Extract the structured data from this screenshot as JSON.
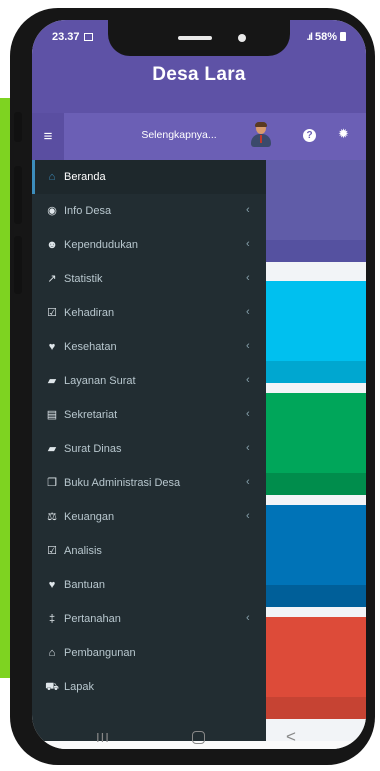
{
  "status": {
    "time": "23.37",
    "signal": ".ıl",
    "battery": "58%"
  },
  "app": {
    "title": "Desa Lara"
  },
  "navbar": {
    "toggle_icon": "menu-icon",
    "title": "Selengkapnya...",
    "avatar_icon": "user-avatar",
    "help_icon": "question-circle-icon",
    "settings_icon": "gear-icon"
  },
  "sidebar": {
    "items": [
      {
        "label": "Beranda",
        "icon": "home-icon",
        "glyph": "⌂",
        "has_submenu": false,
        "active": true
      },
      {
        "label": "Info Desa",
        "icon": "dashboard-icon",
        "glyph": "◉",
        "has_submenu": true
      },
      {
        "label": "Kependudukan",
        "icon": "users-icon",
        "glyph": "☻",
        "has_submenu": true
      },
      {
        "label": "Statistik",
        "icon": "line-chart-icon",
        "glyph": "↗",
        "has_submenu": true
      },
      {
        "label": "Kehadiran",
        "icon": "calendar-check-icon",
        "glyph": "☑",
        "has_submenu": true
      },
      {
        "label": "Kesehatan",
        "icon": "heartbeat-icon",
        "glyph": "♥",
        "has_submenu": true
      },
      {
        "label": "Layanan Surat",
        "icon": "book-icon",
        "glyph": "▰",
        "has_submenu": true
      },
      {
        "label": "Sekretariat",
        "icon": "archive-icon",
        "glyph": "▤",
        "has_submenu": true
      },
      {
        "label": "Surat Dinas",
        "icon": "book-icon",
        "glyph": "▰",
        "has_submenu": true
      },
      {
        "label": "Buku Administrasi Desa",
        "icon": "copy-icon",
        "glyph": "❐",
        "has_submenu": true
      },
      {
        "label": "Keuangan",
        "icon": "balance-scale-icon",
        "glyph": "⚖",
        "has_submenu": true
      },
      {
        "label": "Analisis",
        "icon": "check-square-icon",
        "glyph": "☑",
        "has_submenu": false
      },
      {
        "label": "Bantuan",
        "icon": "heart-icon",
        "glyph": "♥",
        "has_submenu": false
      },
      {
        "label": "Pertanahan",
        "icon": "map-signs-icon",
        "glyph": "‡",
        "has_submenu": true
      },
      {
        "label": "Pembangunan",
        "icon": "bank-icon",
        "glyph": "⌂",
        "has_submenu": false
      },
      {
        "label": "Lapak",
        "icon": "cart-icon",
        "glyph": "⛟",
        "has_submenu": false
      }
    ],
    "chevron_glyph": "‹"
  },
  "content": {
    "cards": [
      {
        "name": "card-purple",
        "color": "#605ca8",
        "foot_color": "#5551a0"
      },
      {
        "name": "card-aqua",
        "color": "#00c0ef",
        "foot_color": "#00a7d0"
      },
      {
        "name": "card-green",
        "color": "#00a65a",
        "foot_color": "#008d4c"
      },
      {
        "name": "card-blue",
        "color": "#0073b7",
        "foot_color": "#005f99"
      },
      {
        "name": "card-red",
        "color": "#dd4b39",
        "foot_color": "#c64333"
      }
    ]
  },
  "system_nav": {
    "recent_glyph": "III",
    "back_glyph": "<"
  },
  "colors": {
    "header": "#5e52a6",
    "navbar": "#6b5fb5",
    "sidebar": "#222d32",
    "page_background": "#7ed321"
  }
}
